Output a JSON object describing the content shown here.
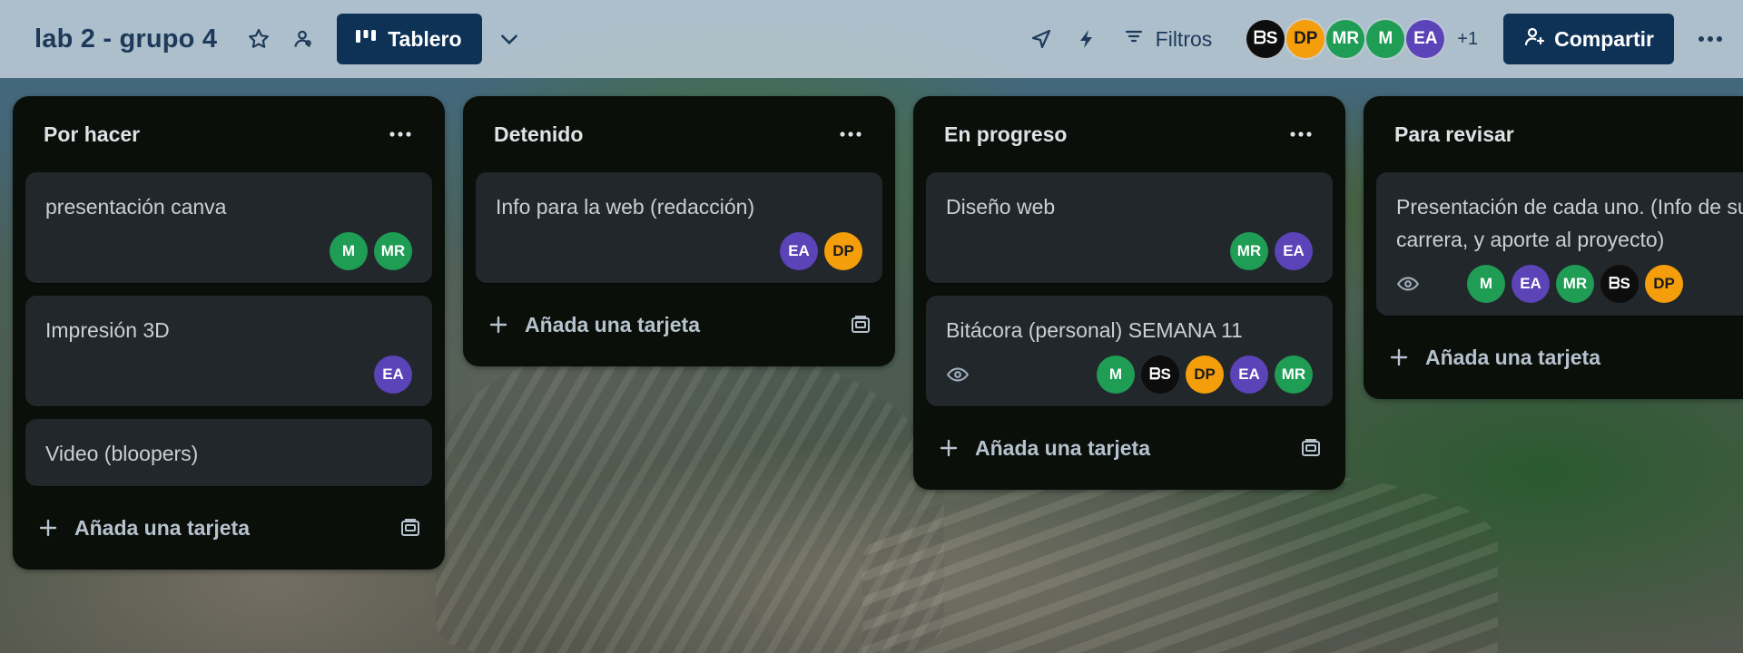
{
  "board": {
    "title": "lab 2 - grupo 4",
    "view_label": "Tablero",
    "filters_label": "Filtros",
    "extra_members": "+1",
    "share_label": "Compartir"
  },
  "header_members": [
    {
      "initials": "ᗷS",
      "color": "#0d0d0d"
    },
    {
      "initials": "DP",
      "color": "#f59e0b"
    },
    {
      "initials": "MR",
      "color": "#1f9d55"
    },
    {
      "initials": "M",
      "color": "#1f9d55"
    },
    {
      "initials": "EA",
      "color": "#5b43b8"
    }
  ],
  "lists": [
    {
      "title": "Por hacer",
      "add_label": "Añada una tarjeta",
      "cards": [
        {
          "title": "presentación canva",
          "members": [
            "M",
            "MR"
          ]
        },
        {
          "title": "Impresión 3D",
          "members": [
            "EA"
          ]
        },
        {
          "title": "Video (bloopers)",
          "members": []
        }
      ]
    },
    {
      "title": "Detenido",
      "add_label": "Añada una tarjeta",
      "cards": [
        {
          "title": "Info para la web (redacción)",
          "members": [
            "EA",
            "DP"
          ]
        }
      ]
    },
    {
      "title": "En progreso",
      "add_label": "Añada una tarjeta",
      "cards": [
        {
          "title": "Diseño web",
          "members": [
            "MR",
            "EA"
          ]
        },
        {
          "title": "Bitácora (personal) SEMANA 11",
          "members": [
            "M",
            "ᗷS",
            "DP",
            "EA",
            "MR"
          ],
          "watching": true
        }
      ]
    },
    {
      "title": "Para revisar",
      "add_label": "Añada una tarjeta",
      "cards": [
        {
          "title": "Presentación de cada uno. (Info de su carrera, y aporte al proyecto)",
          "members": [
            "M",
            "EA",
            "MR",
            "ᗷS",
            "DP"
          ],
          "watching": true
        }
      ]
    }
  ],
  "colors": {
    "list_bg": "#0b0f09",
    "card_bg": "#22272b",
    "accent": "#0e3256"
  }
}
